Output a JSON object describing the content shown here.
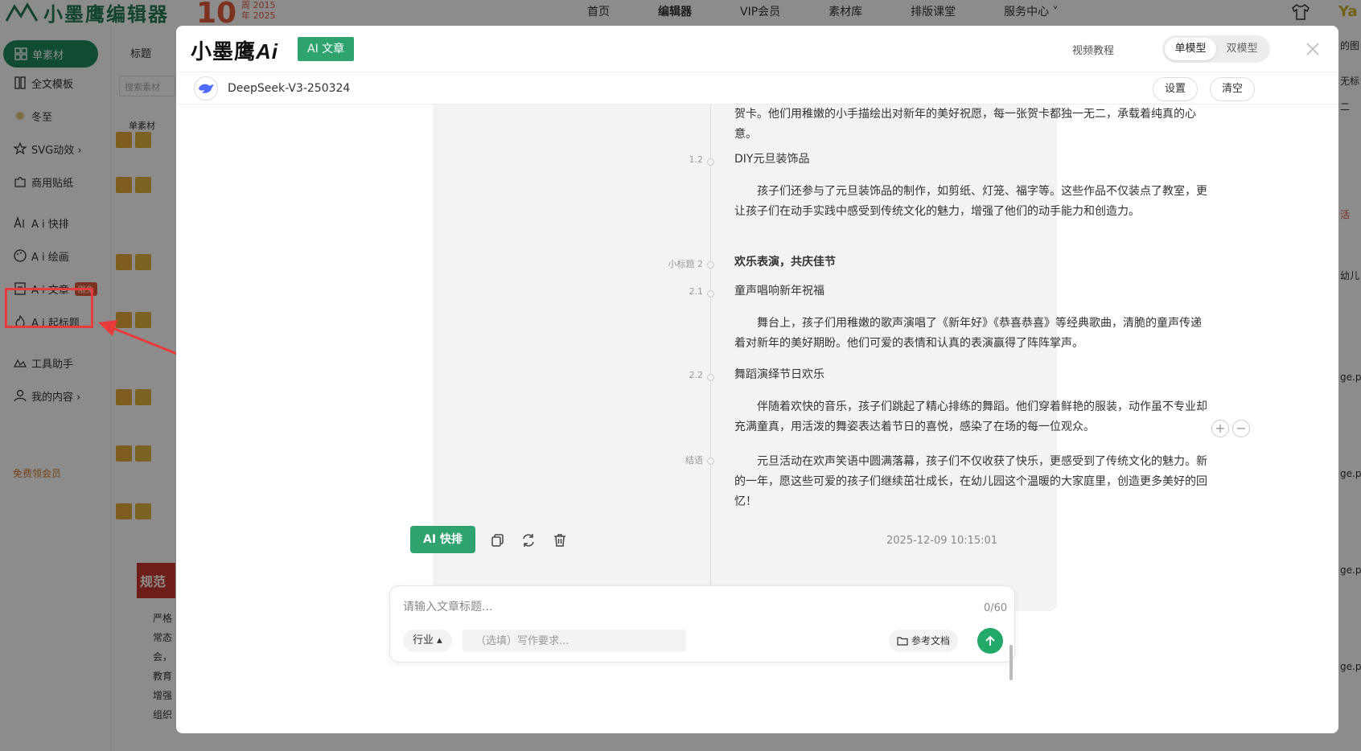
{
  "app": {
    "logo": "小墨鹰编辑器",
    "anniversary_number": "10",
    "anniversary_line1": "周 2015",
    "anniversary_line2": "年 2025",
    "nav": [
      "首页",
      "编辑器",
      "VIP会员",
      "素材库",
      "排版课堂",
      "服务中心 ˅"
    ],
    "nav_active_index": 1,
    "right_glyph": "Ya"
  },
  "sidebar": {
    "primary_button": "单素材",
    "items": [
      {
        "label": "全文模板"
      },
      {
        "label": "冬至"
      },
      {
        "label": "SVG动效 ›"
      },
      {
        "label": "商用贴纸"
      },
      {
        "label": "A i 快排"
      },
      {
        "label": "A i 绘画"
      },
      {
        "label": "A i 文章",
        "badge": "限免"
      },
      {
        "label": "A i 起标题"
      },
      {
        "label": "工具助手"
      },
      {
        "label": "我的内容 ›"
      }
    ],
    "free_vip": "免费领会员"
  },
  "col2": {
    "tab": "标题",
    "search_placeholder": "搜索素材",
    "section_label": "单素材",
    "red_block": "规范",
    "bg_lines": [
      "严格",
      "常态",
      "会，",
      "教育",
      "增强",
      "组织"
    ]
  },
  "rightcol": [
    "的图",
    "无标",
    "二",
    "活",
    "幼儿",
    "ge.p",
    "ge.p",
    "ge.p",
    "ge.p"
  ],
  "modal": {
    "brand": "小墨鹰",
    "brand_ai": "Ai",
    "brand_tag": "AI 文章",
    "video_tutorial": "视频教程",
    "model_options": [
      "单模型",
      "双模型"
    ],
    "model_selected_index": 0,
    "model_name": "DeepSeek-V3-250324",
    "settings": "设置",
    "clear": "清空"
  },
  "article": {
    "top_paragraph": "贺卡。他们用稚嫩的小手描绘出对新年的美好祝愿，每一张贺卡都独一无二，承载着纯真的心意。",
    "sections": [
      {
        "num": "1.2",
        "title": "DIY元旦装饰品",
        "body": "孩子们还参与了元旦装饰品的制作，如剪纸、灯笼、福字等。这些作品不仅装点了教室，更让孩子们在动手实践中感受到传统文化的魅力，增强了他们的动手能力和创造力。"
      },
      {
        "num": "小标题 2",
        "title": "欢乐表演，共庆佳节",
        "bold": true
      },
      {
        "num": "2.1",
        "title": "童声唱响新年祝福",
        "body": "舞台上，孩子们用稚嫩的歌声演唱了《新年好》《恭喜恭喜》等经典歌曲，清脆的童声传递着对新年的美好期盼。他们可爱的表情和认真的表演赢得了阵阵掌声。"
      },
      {
        "num": "2.2",
        "title": "舞蹈演绎节日欢乐",
        "body": "伴随着欢快的音乐，孩子们跳起了精心排练的舞蹈。他们穿着鲜艳的服装，动作虽不专业却充满童真，用活泼的舞姿表达着节日的喜悦，感染了在场的每一位观众。"
      },
      {
        "num": "结语",
        "body": "元旦活动在欢声笑语中圆满落幕，孩子们不仅收获了快乐，更感受到了传统文化的魅力。新的一年，愿这些可爱的孩子们继续茁壮成长，在幼儿园这个温暖的大家庭里，创造更多美好的回忆！"
      }
    ],
    "ai_layout_button": "AI 快排",
    "timestamp": "2025-12-09 10:15:01",
    "plus": "+",
    "minus": "−"
  },
  "composer": {
    "title_placeholder": "请输入文章标题...",
    "counter": "0/60",
    "industry": "行业 ▴",
    "requirement_placeholder": "（选填）写作要求...",
    "reference_docs": "参考文档"
  },
  "colors": {
    "brand_green": "#2ea36d",
    "dark_green": "#1f8a5c",
    "annotation_red": "#e83b3b"
  }
}
